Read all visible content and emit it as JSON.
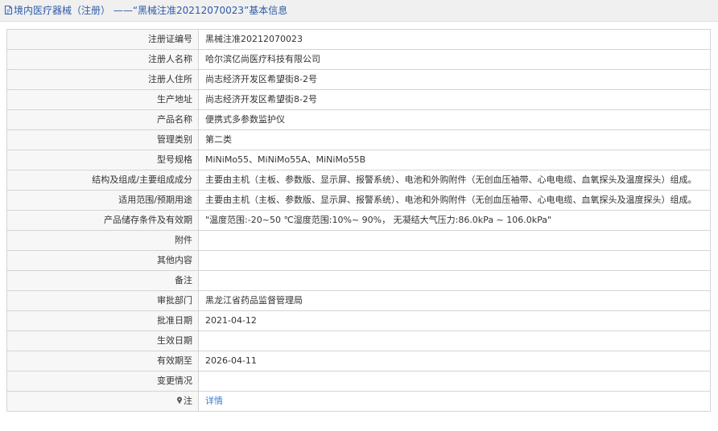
{
  "header": {
    "title": "境内医疗器械（注册） ——“黑械注准20212070023”基本信息"
  },
  "rows": [
    {
      "label": "注册证编号",
      "value": "黑械注准20212070023"
    },
    {
      "label": "注册人名称",
      "value": "哈尔滨亿尚医疗科技有限公司"
    },
    {
      "label": "注册人住所",
      "value": "尚志经济开发区希望街8-2号"
    },
    {
      "label": "生产地址",
      "value": "尚志经济开发区希望街8-2号"
    },
    {
      "label": "产品名称",
      "value": "便携式多参数监护仪"
    },
    {
      "label": "管理类别",
      "value": "第二类"
    },
    {
      "label": "型号规格",
      "value": "MiNiMo55、MiNiMo55A、MiNiMo55B"
    },
    {
      "label": "结构及组成/主要组成成分",
      "value": "主要由主机（主板、参数版、显示屏、报警系统）、电池和外购附件（无创血压袖带、心电电缆、血氧探头及温度探头）组成。"
    },
    {
      "label": "适用范围/预期用途",
      "value": "主要由主机（主板、参数版、显示屏、报警系统）、电池和外购附件（无创血压袖带、心电电缆、血氧探头及温度探头）组成。"
    },
    {
      "label": "产品储存条件及有效期",
      "value": "\"温度范围:-20~50 ℃湿度范围:10%~ 90%， 无凝结大气压力:86.0kPa ~ 106.0kPa\""
    },
    {
      "label": "附件",
      "value": ""
    },
    {
      "label": "其他内容",
      "value": ""
    },
    {
      "label": "备注",
      "value": ""
    },
    {
      "label": "审批部门",
      "value": "黑龙江省药品监督管理局"
    },
    {
      "label": "批准日期",
      "value": "2021-04-12"
    },
    {
      "label": "生效日期",
      "value": ""
    },
    {
      "label": "有效期至",
      "value": "2026-04-11"
    },
    {
      "label": "变更情况",
      "value": ""
    }
  ],
  "note": {
    "label": "注",
    "link_text": "详情",
    "icon": "pin-icon"
  },
  "colors": {
    "title": "#2d5ba8",
    "link": "#3a7bd5",
    "border": "#d4d4d4",
    "label_bg": "#f7f7f7"
  }
}
